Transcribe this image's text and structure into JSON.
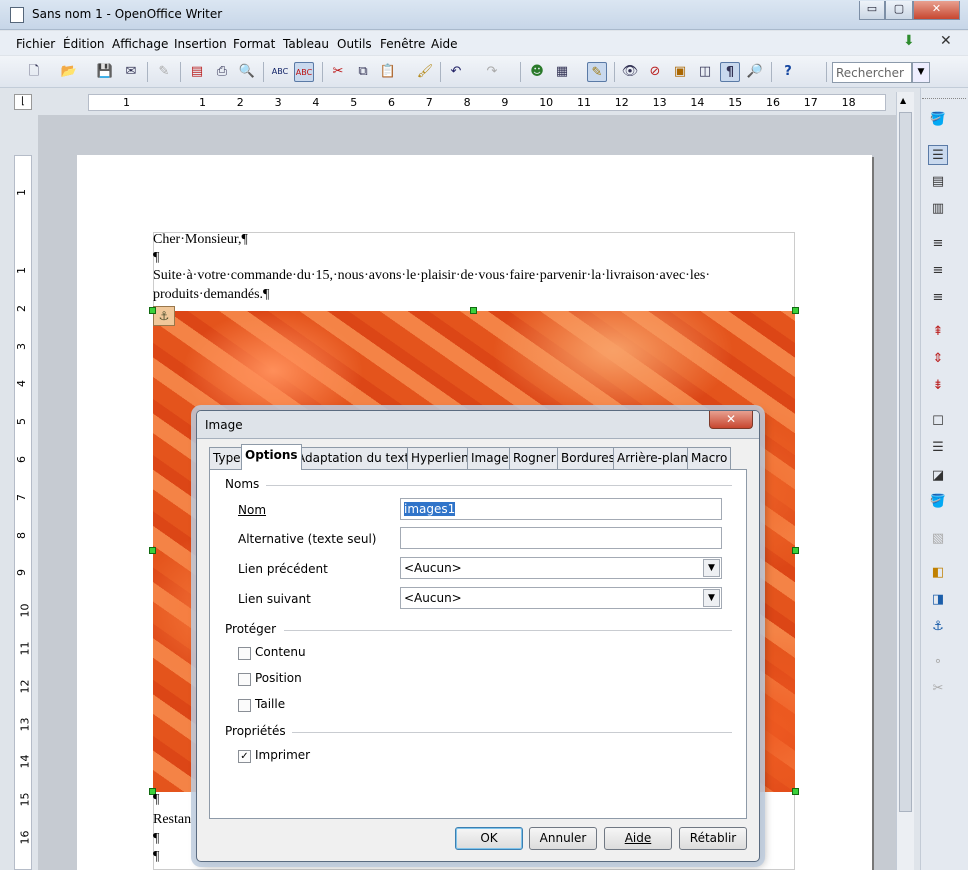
{
  "window": {
    "title": "Sans nom 1 - OpenOffice Writer",
    "min": "▭",
    "max": "▢",
    "close": "✕"
  },
  "menu": [
    "Fichier",
    "Édition",
    "Affichage",
    "Insertion",
    "Format",
    "Tableau",
    "Outils",
    "Fenêtre",
    "Aide"
  ],
  "toolbar": {
    "search_placeholder": "Rechercher"
  },
  "ruler": {
    "h_ticks": [
      "1",
      "1",
      "2",
      "3",
      "4",
      "5",
      "6",
      "7",
      "8",
      "9",
      "10",
      "11",
      "12",
      "13",
      "14",
      "15",
      "16",
      "17",
      "18"
    ],
    "v_ticks": [
      "1",
      "1",
      "2",
      "3",
      "4",
      "5",
      "6",
      "7",
      "8",
      "9",
      "10",
      "11",
      "12",
      "13",
      "14",
      "15",
      "16"
    ]
  },
  "document": {
    "lines": [
      "Cher·Monsieur,¶",
      "¶",
      "Suite·à·votre·commande·du·15,·nous·avons·le·plaisir·de·vous·faire·parvenir·la·livraison·avec·les·",
      "produits·demandés.¶"
    ],
    "after_image": [
      "¶",
      "Restan",
      "¶",
      "¶"
    ]
  },
  "dialog": {
    "title": "Image",
    "tabs": [
      "Type",
      "Options",
      "Adaptation du texte",
      "Hyperlien",
      "Image",
      "Rogner",
      "Bordures",
      "Arrière-plan",
      "Macro"
    ],
    "active_tab": "Options",
    "names": {
      "section": "Noms",
      "name_label": "Nom",
      "name_value": "images1",
      "alt_label": "Alternative (texte seul)",
      "alt_value": "",
      "prev_label": "Lien précédent",
      "prev_value": "<Aucun>",
      "next_label": "Lien suivant",
      "next_value": "<Aucun>"
    },
    "protect": {
      "section": "Protéger",
      "content": "Contenu",
      "position": "Position",
      "size": "Taille"
    },
    "props": {
      "section": "Propriétés",
      "print": "Imprimer",
      "print_checked": true
    },
    "buttons": {
      "ok": "OK",
      "cancel": "Annuler",
      "help": "Aide",
      "reset": "Rétablir"
    }
  }
}
